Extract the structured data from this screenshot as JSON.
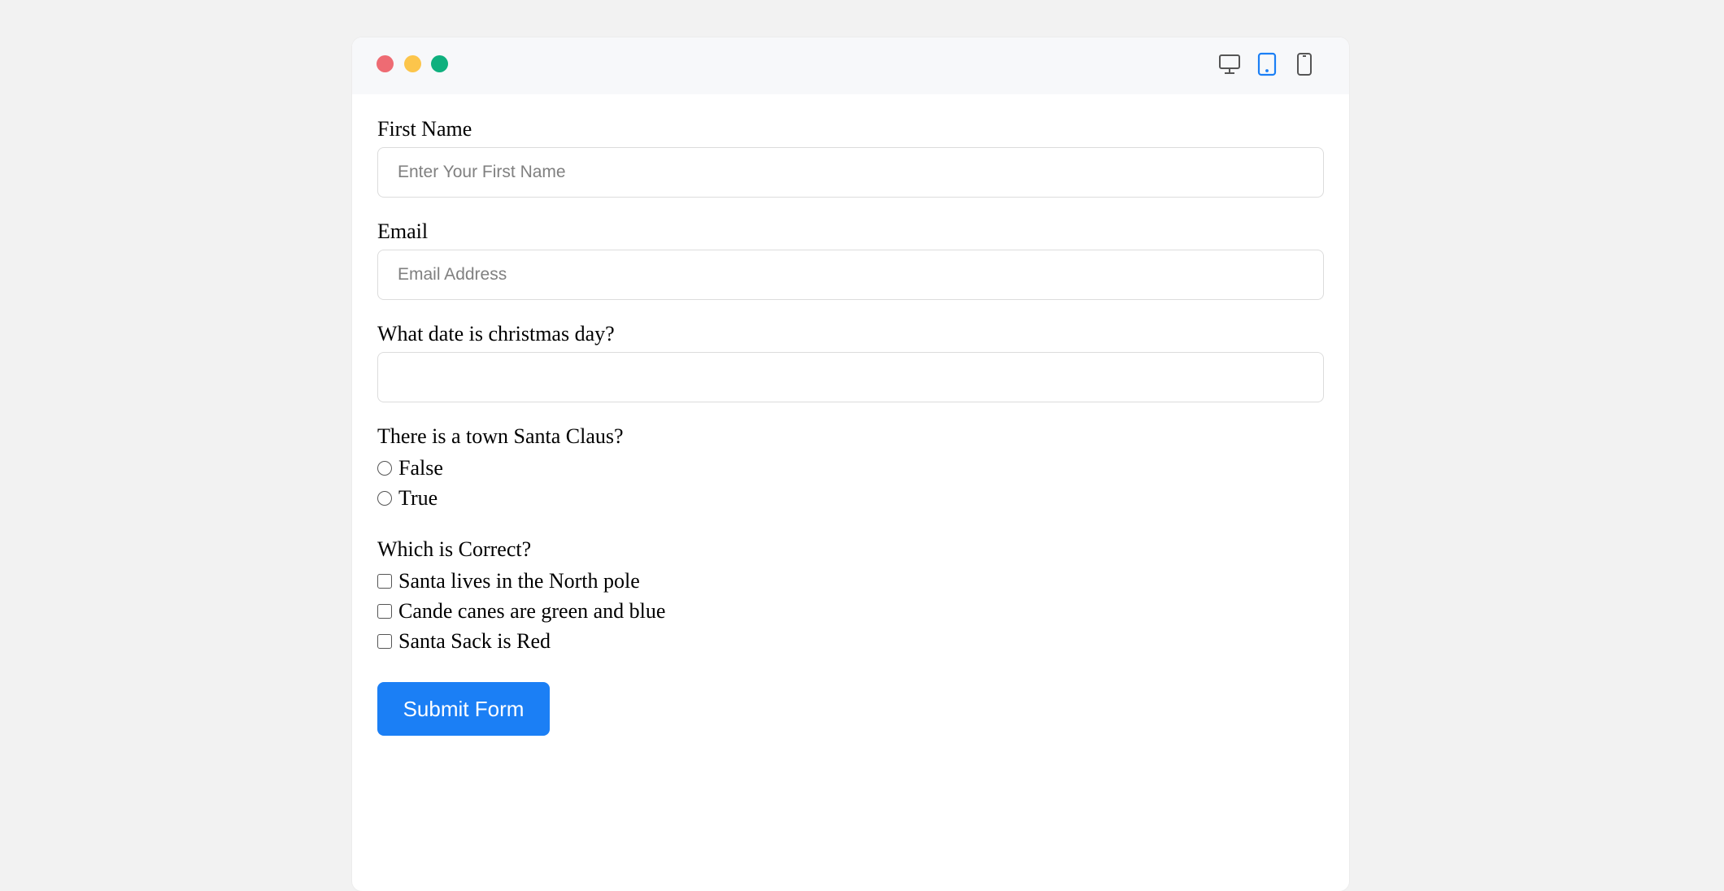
{
  "window_controls": {
    "close_color": "#ee6b73",
    "minimize_color": "#fcc54b",
    "maximize_color": "#0fb07e"
  },
  "device_toggle": {
    "items": [
      {
        "icon": "desktop-icon",
        "active": false
      },
      {
        "icon": "tablet-icon",
        "active": true
      },
      {
        "icon": "mobile-icon",
        "active": false
      }
    ],
    "active_color": "#1b7ff5",
    "inactive_color": "#555555"
  },
  "form": {
    "first_name": {
      "label": "First Name",
      "placeholder": "Enter Your First Name",
      "value": ""
    },
    "email": {
      "label": "Email",
      "placeholder": "Email Address",
      "value": ""
    },
    "christmas_date": {
      "label": "What date is christmas day?",
      "placeholder": "",
      "value": ""
    },
    "santa_town": {
      "label": "There is a town Santa Claus?",
      "options": [
        "False",
        "True"
      ]
    },
    "which_correct": {
      "label": "Which is Correct?",
      "options": [
        "Santa lives in the North pole",
        "Cande canes are green and blue",
        "Santa Sack is Red"
      ]
    },
    "submit_label": "Submit Form",
    "submit_color": "#1b7ff5"
  }
}
